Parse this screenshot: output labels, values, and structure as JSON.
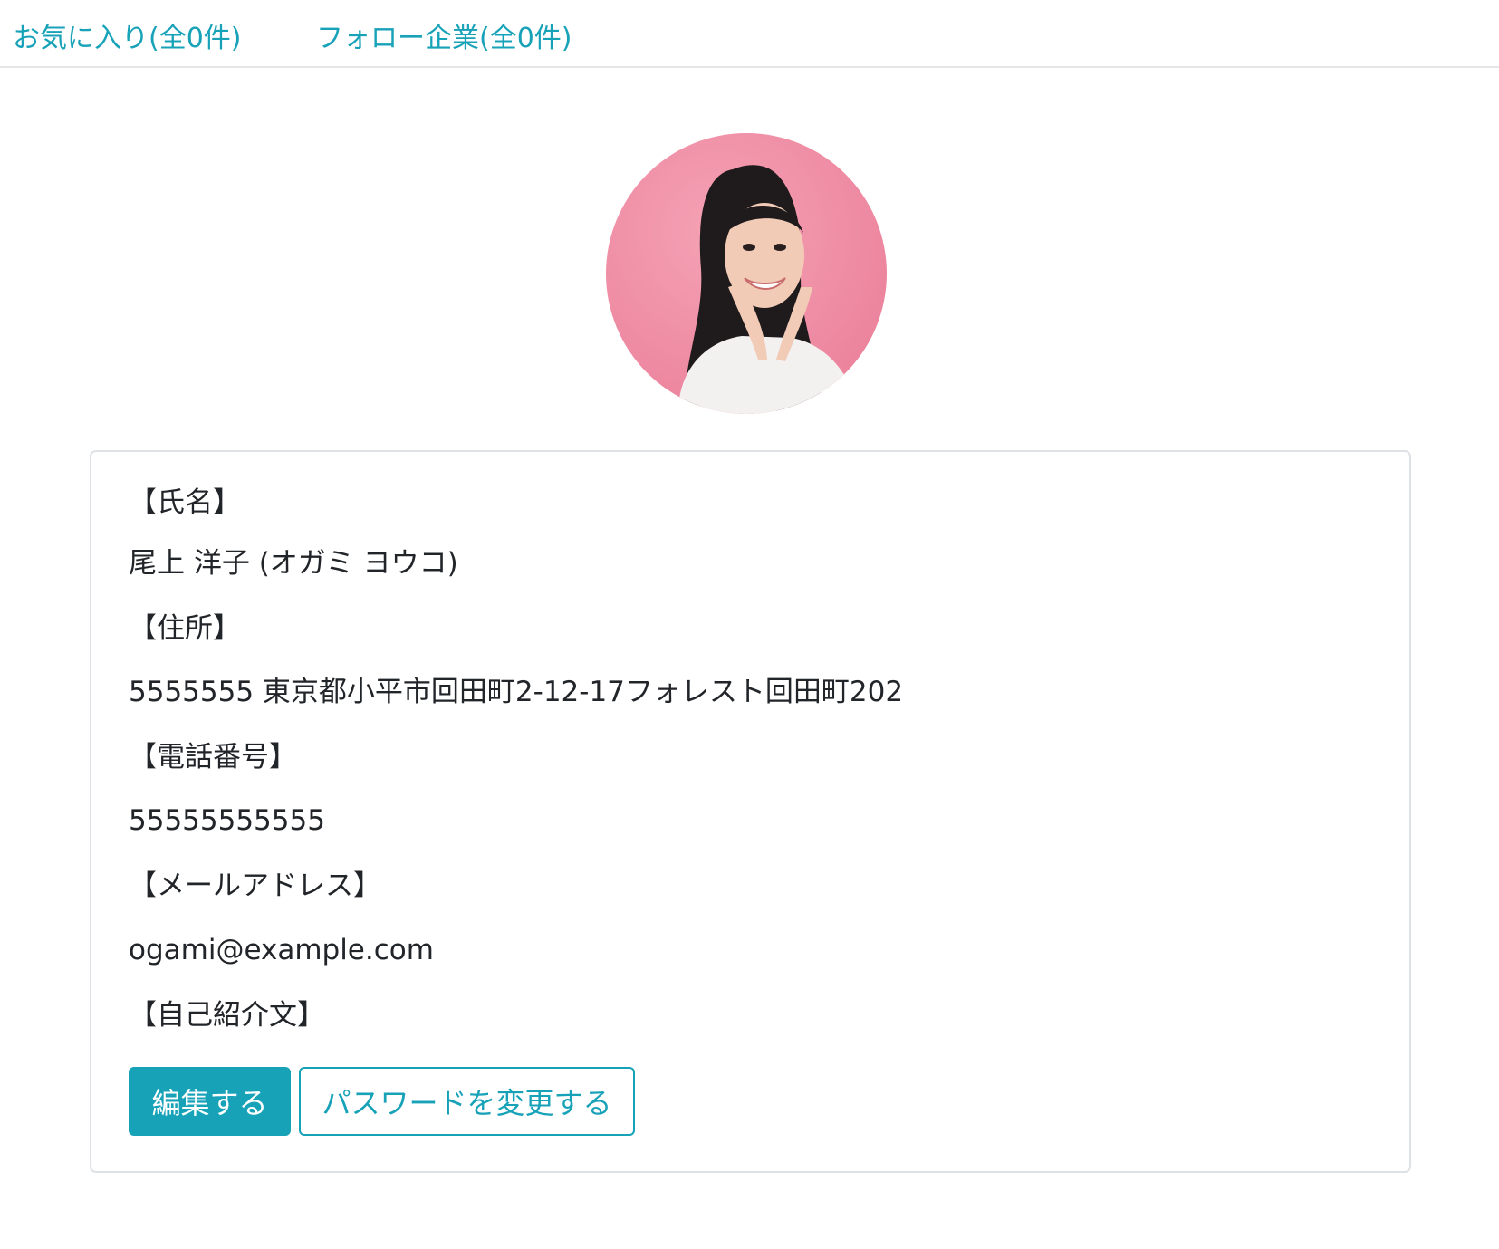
{
  "nav": {
    "favorites": "お気に入り(全0件)",
    "follow": "フォロー企業(全0件)"
  },
  "profile": {
    "avatar_alt": "プロフィール画像",
    "name_label": "【氏名】",
    "name_value": "尾上 洋子 (オガミ ヨウコ)",
    "address_label": "【住所】",
    "address_value": "5555555 東京都小平市回田町2-12-17フォレスト回田町202",
    "phone_label": "【電話番号】",
    "phone_value": "55555555555",
    "email_label": "【メールアドレス】",
    "email_value": "ogami@example.com",
    "bio_label": "【自己紹介文】",
    "bio_value": ""
  },
  "actions": {
    "edit": "編集する",
    "change_password": "パスワードを変更する"
  },
  "colors": {
    "accent": "#17a2b8",
    "text": "#212529",
    "border": "#dee2e6",
    "avatar_background": "#ef8fa6"
  }
}
